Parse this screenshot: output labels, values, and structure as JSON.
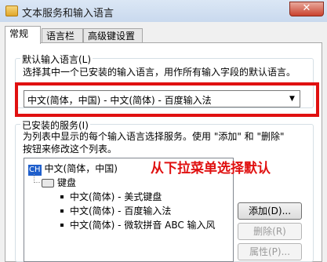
{
  "window": {
    "title": "文本服务和输入语言",
    "close_glyph": "✕"
  },
  "tabs": [
    {
      "label": "常规",
      "active": true
    },
    {
      "label": "语言栏",
      "active": false
    },
    {
      "label": "高级键设置",
      "active": false
    }
  ],
  "default_language": {
    "group_label": "默认输入语言(L)",
    "description": "选择其中一个已安装的输入语言，用作所有输入字段的默认语言。",
    "selected_value": "中文(简体，中国) - 中文(简体) - 百度输入法"
  },
  "installed_services": {
    "group_label": "已安装的服务(I)",
    "description_line1": "为列表中显示的每个输入语言选择服务。使用 \"添加\" 和 \"删除\"",
    "description_line2": "按钮来修改这个列表。",
    "tree": {
      "language": {
        "badge": "CH",
        "label": "中文(简体，中国)"
      },
      "category": "键盘",
      "items": [
        "中文(简体) - 美式键盘",
        "中文(简体) - 百度输入法",
        "中文(简体) - 微软拼音 ABC 输入风"
      ]
    },
    "buttons": {
      "add": "添加(D)...",
      "remove": "删除(R)",
      "properties": "属性(P)..."
    }
  },
  "annotation": "从下拉菜单选择默认"
}
